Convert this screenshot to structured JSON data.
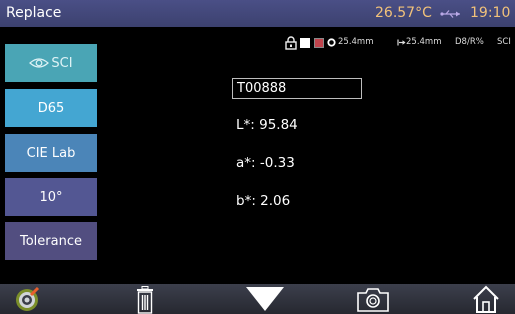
{
  "title": "Replace",
  "status": {
    "temperature": "26.57°C",
    "time": "19:10",
    "aperture": "25.4mm",
    "measure_area": "25.4mm",
    "geometry": "D8/R%",
    "mode": "SCI"
  },
  "sidebar": [
    {
      "label": "SCI"
    },
    {
      "label": "D65"
    },
    {
      "label": "CIE Lab"
    },
    {
      "label": "10°"
    },
    {
      "label": "Tolerance"
    }
  ],
  "sample_id": "T00888",
  "values": {
    "L": "L*: 95.84",
    "a": "a*: -0.33",
    "b": "b*: 2.06"
  },
  "colors": {
    "titlebar": "#3c416f",
    "title_accent": "#f2c27a",
    "swatch": "#c0444d"
  },
  "bottom_icons": [
    "color-wheel-icon",
    "trash-icon",
    "measure-triangle-icon",
    "camera-icon",
    "home-icon"
  ]
}
